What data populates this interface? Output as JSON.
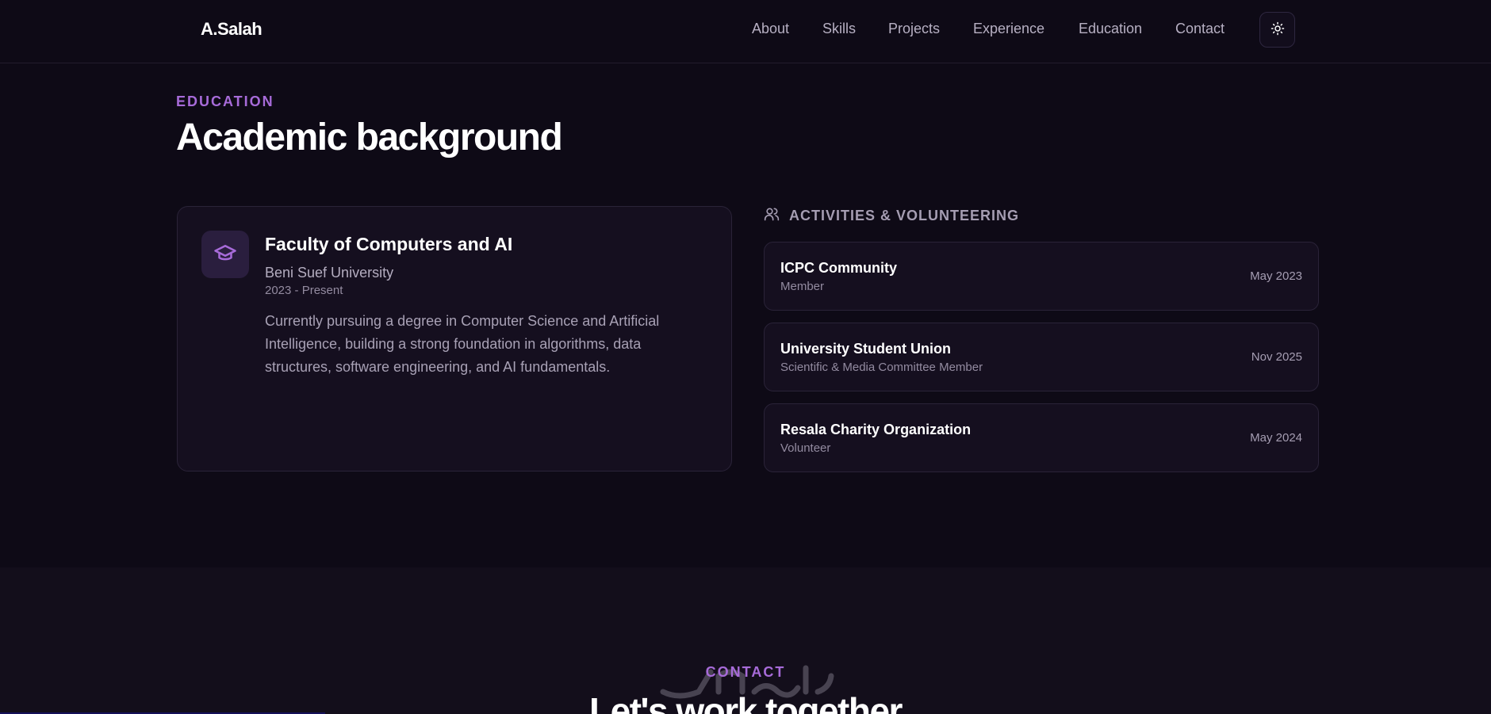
{
  "nav": {
    "brand": "A.Salah",
    "links": [
      "About",
      "Skills",
      "Projects",
      "Experience",
      "Education",
      "Contact"
    ],
    "theme_toggle_icon": "sun-icon"
  },
  "education": {
    "eyebrow": "EDUCATION",
    "title": "Academic background",
    "card": {
      "icon": "graduation-cap-icon",
      "degree": "Faculty of Computers and AI",
      "university": "Beni Suef University",
      "dates": "2023 - Present",
      "description": "Currently pursuing a degree in Computer Science and Artificial Intelligence, building a strong foundation in algorithms, data structures, software engineering, and AI fundamentals."
    },
    "activities": {
      "heading": "ACTIVITIES & VOLUNTEERING",
      "icon": "users-icon",
      "items": [
        {
          "name": "ICPC Community",
          "role": "Member",
          "date": "May 2023"
        },
        {
          "name": "University Student Union",
          "role": "Scientific & Media Committee Member",
          "date": "Nov 2025"
        },
        {
          "name": "Resala Charity Organization",
          "role": "Volunteer",
          "date": "May 2024"
        }
      ]
    }
  },
  "contact": {
    "eyebrow": "CONTACT",
    "title": "Let's work together"
  },
  "colors": {
    "background": "#0e0a16",
    "accent": "#a76bd9",
    "card": "#150f1f"
  }
}
